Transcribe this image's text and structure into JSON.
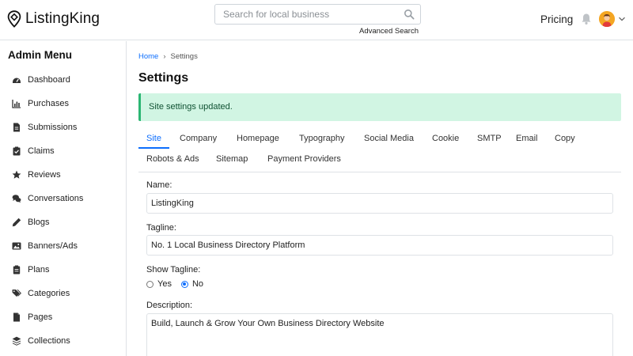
{
  "header": {
    "logo_text": "ListingKing",
    "search_placeholder": "Search for local business",
    "advanced_search": "Advanced Search",
    "pricing": "Pricing"
  },
  "sidebar": {
    "title": "Admin Menu",
    "items": [
      {
        "label": "Dashboard",
        "icon": "dashboard-icon"
      },
      {
        "label": "Purchases",
        "icon": "chart-icon"
      },
      {
        "label": "Submissions",
        "icon": "file-icon"
      },
      {
        "label": "Claims",
        "icon": "clipboard-check-icon"
      },
      {
        "label": "Reviews",
        "icon": "star-icon"
      },
      {
        "label": "Conversations",
        "icon": "comments-icon"
      },
      {
        "label": "Blogs",
        "icon": "pencil-icon"
      },
      {
        "label": "Banners/Ads",
        "icon": "image-icon"
      },
      {
        "label": "Plans",
        "icon": "clipboard-icon"
      },
      {
        "label": "Categories",
        "icon": "tags-icon"
      },
      {
        "label": "Pages",
        "icon": "page-icon"
      },
      {
        "label": "Collections",
        "icon": "layers-icon"
      }
    ]
  },
  "main": {
    "breadcrumb": {
      "home": "Home",
      "separator": "›",
      "current": "Settings"
    },
    "title": "Settings",
    "alert": "Site settings updated.",
    "tabs": [
      "Site",
      "Company",
      "Homepage",
      "Typography",
      "Social Media",
      "Cookie",
      "SMTP",
      "Email",
      "Copy",
      "Robots & Ads",
      "Sitemap",
      "Payment Providers"
    ],
    "active_tab": "Site",
    "form": {
      "name_label": "Name:",
      "name_value": "ListingKing",
      "tagline_label": "Tagline:",
      "tagline_value": "No. 1 Local Business Directory Platform",
      "show_tagline_label": "Show Tagline:",
      "show_tagline_yes": "Yes",
      "show_tagline_no": "No",
      "show_tagline_selected": "No",
      "description_label": "Description:",
      "description_value": "Build, Launch & Grow Your Own Business Directory Website"
    }
  },
  "colors": {
    "accent": "#0d6efd",
    "alert_bg": "#d1f5e3",
    "alert_border": "#2bb673",
    "alert_text": "#0f5132"
  }
}
